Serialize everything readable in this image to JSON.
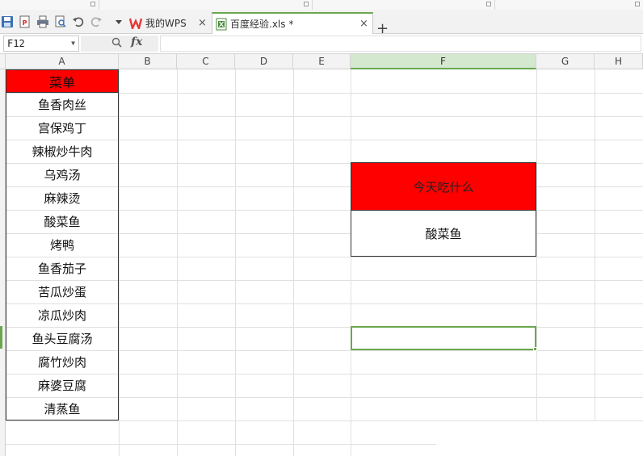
{
  "quick_access": [
    "save-icon",
    "export-pdf-icon",
    "print-icon",
    "print-preview-icon",
    "undo-icon",
    "redo-icon",
    "dropdown-arrow-icon"
  ],
  "tabs": [
    {
      "label": "我的WPS",
      "icon": "wps-logo-icon",
      "close": "×"
    },
    {
      "label": "百度经验.xls *",
      "icon": "spreadsheet-file-icon",
      "close": "×"
    }
  ],
  "new_tab_label": "+",
  "formula_bar": {
    "cell_ref": "F12",
    "value": ""
  },
  "columns": [
    "A",
    "B",
    "C",
    "D",
    "E",
    "F",
    "G",
    "H"
  ],
  "active_column": "F",
  "menu": {
    "header": "菜单",
    "items": [
      "鱼香肉丝",
      "宫保鸡丁",
      "辣椒炒牛肉",
      "乌鸡汤",
      "麻辣烫",
      "酸菜鱼",
      "烤鸭",
      "鱼香茄子",
      "苦瓜炒蛋",
      "凉瓜炒肉",
      "鱼头豆腐汤",
      "腐竹炒肉",
      "麻婆豆腐",
      "清蒸鱼"
    ]
  },
  "today": {
    "header": "今天吃什么",
    "value": "酸菜鱼"
  },
  "colors": {
    "header_fill": "#ff0000",
    "selection": "#6aa84f",
    "grid": "#e0e0e0"
  }
}
